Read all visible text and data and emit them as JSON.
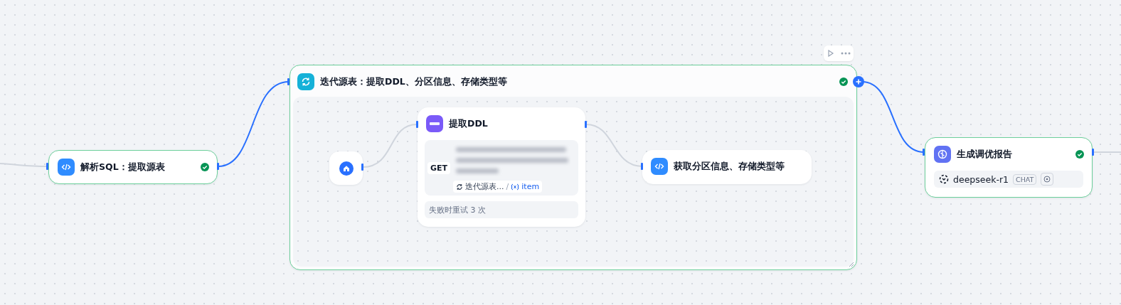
{
  "canvas": {
    "nodes": [
      {
        "kind": "code",
        "title": "解析SQL：提取源表",
        "succeeded": true
      },
      {
        "kind": "iteration",
        "title": "迭代源表：提取DDL、分区信息、存储类型等",
        "succeeded": true,
        "children": [
          {
            "kind": "start"
          },
          {
            "kind": "http",
            "title": "提取DDL",
            "method": "GET",
            "variable": {
              "source": "迭代源表...",
              "separator": "/",
              "name": "item"
            },
            "retry": "失败时重试 3 次"
          },
          {
            "kind": "code",
            "title": "获取分区信息、存储类型等"
          }
        ]
      },
      {
        "kind": "llm",
        "title": "生成调优报告",
        "succeeded": true,
        "model": "deepseek-r1",
        "mode": "CHAT"
      }
    ]
  }
}
